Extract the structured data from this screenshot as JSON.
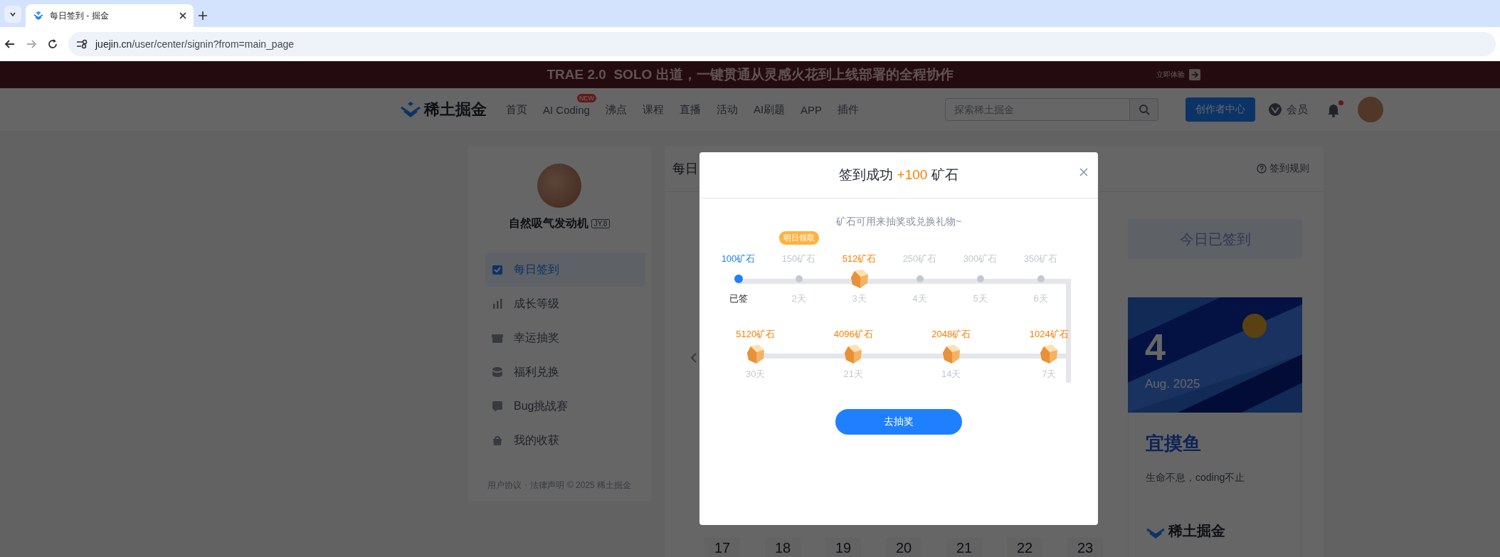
{
  "browser": {
    "tab_title": "每日签到 - 掘金",
    "url_host": "juejin.cn",
    "url_path": "/user/center/signin?from=main_page"
  },
  "banner": {
    "text": "TRAE 2.0  SOLO 出道，一键贯通从灵感火花到上线部署的全程协作",
    "action": "立即体验"
  },
  "nav": {
    "logo": "稀土掘金",
    "items": [
      {
        "label": "首页"
      },
      {
        "label": "AI Coding",
        "badge": "NEW"
      },
      {
        "label": "沸点"
      },
      {
        "label": "课程"
      },
      {
        "label": "直播"
      },
      {
        "label": "活动"
      },
      {
        "label": "AI刷题"
      },
      {
        "label": "APP"
      },
      {
        "label": "插件"
      }
    ],
    "search": {
      "placeholder": "探索稀土掘金"
    },
    "creator_button": "创作者中心",
    "vip": "会员",
    "unread": true
  },
  "sidebar": {
    "user_name": "自然吸气发动机",
    "level": "JY.8",
    "menu": [
      {
        "label": "每日签到",
        "selected": true
      },
      {
        "label": "成长等级",
        "selected": false
      },
      {
        "label": "幸运抽奖",
        "selected": false
      },
      {
        "label": "福利兑换",
        "selected": false
      },
      {
        "label": "Bug挑战赛",
        "selected": false
      },
      {
        "label": "我的收获",
        "selected": false
      }
    ],
    "footer_links": [
      "用户协议",
      "法律声明"
    ],
    "footer_separator": "·",
    "copyright": "© 2025 稀土掘金"
  },
  "main": {
    "title": "每日",
    "rules": "签到规则",
    "calendar_days": [
      "17",
      "18",
      "19",
      "20",
      "21",
      "22",
      "23"
    ],
    "status_button": "今日已签到",
    "day_card": {
      "day": "4",
      "month": "Aug. 2025",
      "fortune": "宜摸鱼",
      "motto": "生命不息，coding不止",
      "logo": "稀土掘金"
    }
  },
  "modal": {
    "title": "签到成功",
    "amount": "+100",
    "unit": "矿石",
    "subtitle": "矿石可用来抽奖或兑换礼物~",
    "week": [
      {
        "reward": "100矿石",
        "day": "已签",
        "kind": "signed"
      },
      {
        "reward": "150矿石",
        "day": "2天",
        "kind": "dot",
        "tip": "明日领取"
      },
      {
        "reward": "512矿石",
        "day": "3天",
        "kind": "ore"
      },
      {
        "reward": "250矿石",
        "day": "4天",
        "kind": "dot"
      },
      {
        "reward": "300矿石",
        "day": "5天",
        "kind": "dot"
      },
      {
        "reward": "350矿石",
        "day": "6天",
        "kind": "dot"
      }
    ],
    "milestones": [
      {
        "reward": "5120矿石",
        "day": "30天",
        "kind": "ore"
      },
      {
        "reward": "4096矿石",
        "day": "21天",
        "kind": "ore"
      },
      {
        "reward": "2048矿石",
        "day": "14天",
        "kind": "ore"
      },
      {
        "reward": "1024矿石",
        "day": "7天",
        "kind": "ore"
      }
    ],
    "button": "去抽奖"
  }
}
